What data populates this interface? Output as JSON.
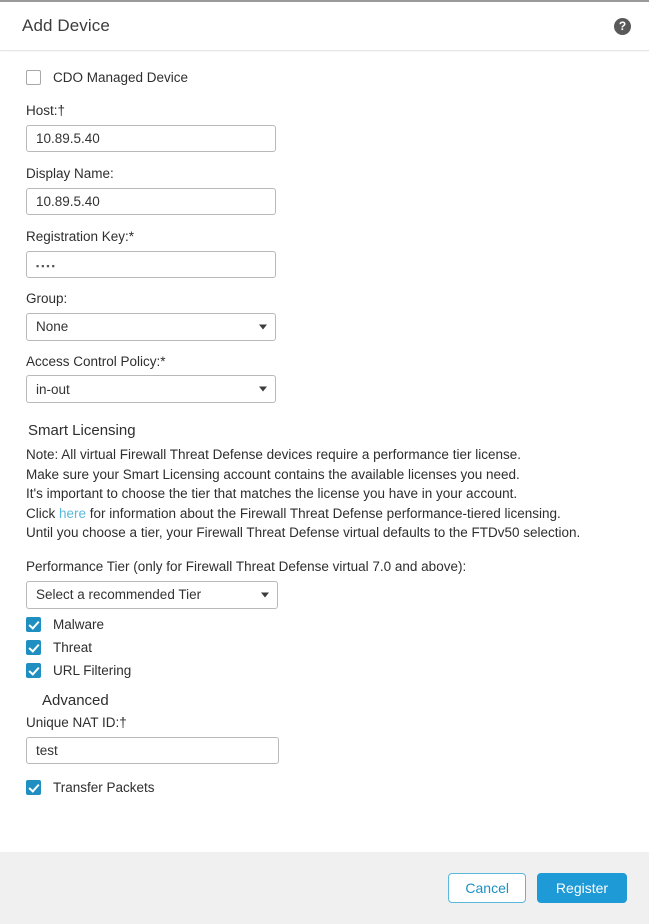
{
  "header": {
    "title": "Add Device",
    "help_icon": "help-circle-icon",
    "help_glyph": "?"
  },
  "form": {
    "cdo_managed": {
      "label": "CDO Managed Device",
      "checked": false
    },
    "host": {
      "label": "Host:†",
      "value": "10.89.5.40",
      "placeholder": ""
    },
    "display_name": {
      "label": "Display Name:",
      "value": "10.89.5.40",
      "placeholder": ""
    },
    "registration_key": {
      "label": "Registration Key:*",
      "value": "▪▪▪▪",
      "placeholder": ""
    },
    "group": {
      "label": "Group:",
      "value": "None",
      "options": [
        "None"
      ]
    },
    "access_control_policy": {
      "label": "Access Control Policy:*",
      "value": "in-out",
      "options": [
        "in-out"
      ]
    }
  },
  "smart_licensing": {
    "heading": "Smart Licensing",
    "note_line_1": "Note: All virtual Firewall Threat Defense devices require a performance tier license.",
    "note_line_2": "Make sure your Smart Licensing account contains the available licenses you need.",
    "note_line_3": "It's important to choose the tier that matches the license you have in your account.",
    "note_line_4_pre": "Click ",
    "note_line_4_link": "here",
    "note_line_4_post": " for information about the Firewall Threat Defense performance-tiered licensing.",
    "note_line_5": "Until you choose a tier, your Firewall Threat Defense virtual defaults to the FTDv50 selection.",
    "performance_tier": {
      "label": "Performance Tier (only for Firewall Threat Defense virtual 7.0 and above):",
      "value": "Select a recommended Tier",
      "options": [
        "Select a recommended Tier"
      ]
    },
    "licenses": [
      {
        "label": "Malware",
        "checked": true
      },
      {
        "label": "Threat",
        "checked": true
      },
      {
        "label": "URL Filtering",
        "checked": true
      }
    ]
  },
  "advanced": {
    "heading": "Advanced",
    "unique_nat_id": {
      "label": "Unique NAT ID:†",
      "value": "test",
      "placeholder": ""
    },
    "transfer_packets": {
      "label": "Transfer Packets",
      "checked": true
    }
  },
  "footer": {
    "cancel_label": "Cancel",
    "register_label": "Register"
  },
  "colors": {
    "accent_blue": "#1e9ad6",
    "checkbox_blue": "#1e8fc0",
    "link_blue": "#5bb8dd",
    "footer_bg": "#f0f0f0",
    "help_icon_bg": "#595959"
  }
}
